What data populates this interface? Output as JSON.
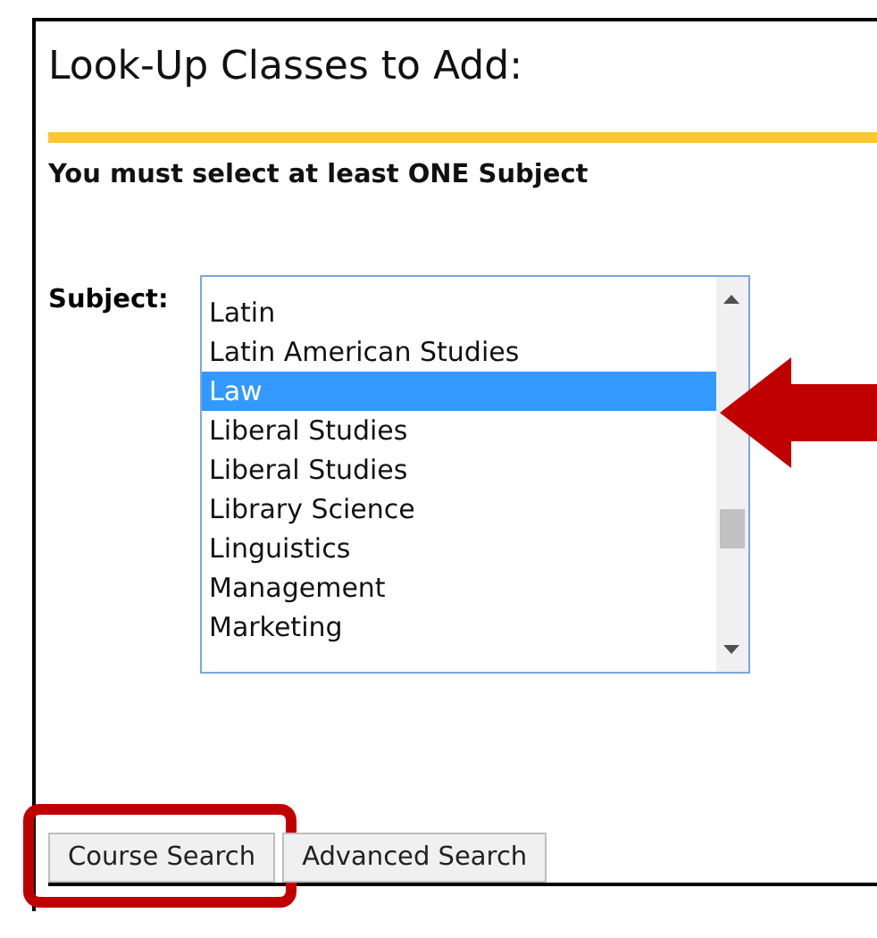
{
  "heading": "Look-Up Classes to Add:",
  "notice": "You must select at least ONE Subject",
  "subject": {
    "label": "Subject:",
    "options": [
      {
        "label": "Latin",
        "selected": false
      },
      {
        "label": "Latin American Studies",
        "selected": false
      },
      {
        "label": "Law",
        "selected": true
      },
      {
        "label": "Liberal Studies",
        "selected": false
      },
      {
        "label": "Liberal Studies",
        "selected": false
      },
      {
        "label": "Library Science",
        "selected": false
      },
      {
        "label": "Linguistics",
        "selected": false
      },
      {
        "label": "Management",
        "selected": false
      },
      {
        "label": "Marketing",
        "selected": false
      }
    ]
  },
  "buttons": [
    {
      "label": "Course Search",
      "highlighted": true
    },
    {
      "label": "Advanced Search",
      "highlighted": false
    }
  ]
}
